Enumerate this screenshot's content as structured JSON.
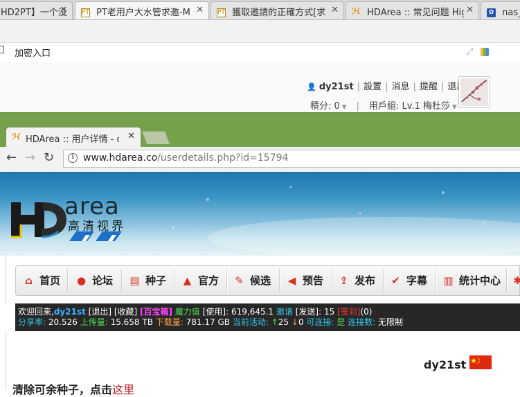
{
  "outer_tabs": [
    {
      "title": "HD2PT】一个没",
      "icon": "page-icon"
    },
    {
      "title": "PT老用户大水管求邀-M",
      "icon": "pt-favicon"
    },
    {
      "title": "獲取邀請的正確方式[求",
      "icon": "pt-favicon"
    },
    {
      "title": "HDArea :: 常见问题 High",
      "icon": "hdarea-favicon"
    },
    {
      "title": "nas_百",
      "icon": "paw-favicon"
    }
  ],
  "bookmark": {
    "label": "加密入口"
  },
  "user_header": {
    "username": "dy21st",
    "settings": "設置",
    "messages": "消息",
    "reminders": "提醒",
    "logout": "退出",
    "points": "積分: 0",
    "group": "用戶組: Lv.1 梅杜莎"
  },
  "inner_tab": {
    "title": "HDArea :: 用户详情 - dy"
  },
  "address": {
    "domain": "www.hdarea.co",
    "path": "/userdetails.php?id=15794"
  },
  "banner": {
    "logo_word": "area",
    "logo_sub": "高清视界"
  },
  "nav": [
    {
      "label": "首页",
      "icon": "home-icon",
      "glyph": "⌂"
    },
    {
      "label": "论坛",
      "icon": "chat-icon",
      "glyph": "●"
    },
    {
      "label": "种子",
      "icon": "torrent-list-icon",
      "glyph": "▤"
    },
    {
      "label": "官方",
      "icon": "person-icon",
      "glyph": "▲"
    },
    {
      "label": "候选",
      "icon": "hammer-icon",
      "glyph": "✎"
    },
    {
      "label": "预告",
      "icon": "megaphone-icon",
      "glyph": "◀"
    },
    {
      "label": "发布",
      "icon": "upload-icon",
      "glyph": "⇪"
    },
    {
      "label": "字幕",
      "icon": "abc-check-icon",
      "glyph": "✔"
    },
    {
      "label": "统计中心",
      "icon": "bar-chart-icon",
      "glyph": "▥"
    }
  ],
  "info": {
    "welcome": "欢迎回来,",
    "username": "dy21st",
    "logout": "[退出]",
    "favorites": "[收藏]",
    "box": "[百宝箱]",
    "bonus_label": "魔力值",
    "used_label": "[使用]:",
    "bonus_value": "619,645.1",
    "invite_label": "邀请",
    "send_label": "[发送]:",
    "invite_value": "15",
    "signin": "[签到]",
    "signin_value": "(0)",
    "ratio_label": "分享率:",
    "ratio_value": "20.526",
    "uploaded_label": "上传量:",
    "uploaded_value": "15.658 TB",
    "downloaded_label": "下载量:",
    "downloaded_value": "781.17 GB",
    "active_label": "当前活动:",
    "seeding": "25",
    "leeching": "0",
    "connectable_label": "可连接:",
    "connectable_value": "是",
    "connections_label": "连接数:",
    "connections_value": "无限制"
  },
  "content": {
    "username": "dy21st",
    "clear_text": "清除可余种子，点击",
    "clear_link": "这里"
  },
  "colors": {
    "frame_green": "#74a14a",
    "nav_icon_red": "#d93025",
    "link_red": "#b5121b"
  }
}
